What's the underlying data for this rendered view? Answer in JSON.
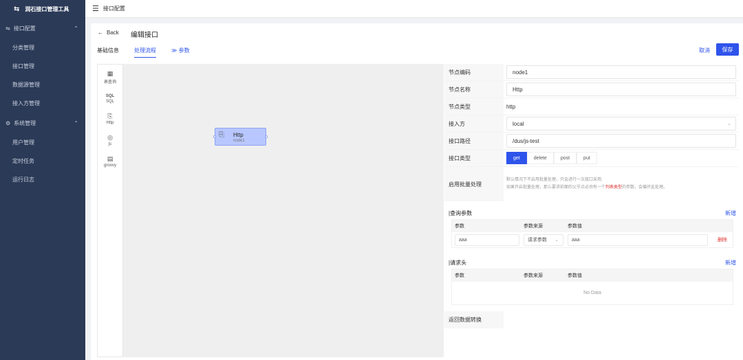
{
  "app": {
    "logo_glyph": "⇆",
    "title": "润石接口管理工具"
  },
  "sidebar": {
    "groups": [
      {
        "label": "接口配置",
        "icon": "link-icon",
        "items": [
          "分类管理",
          "接口管理",
          "数据源管理",
          "接入方管理"
        ]
      },
      {
        "label": "系统管理",
        "icon": "gear-icon",
        "items": [
          "用户管理",
          "定时任务",
          "运行日志"
        ]
      }
    ]
  },
  "header": {
    "breadcrumb": "接口配置"
  },
  "page": {
    "back_label": "Back",
    "title": "编辑接口",
    "tabs": [
      "基础信息",
      "处理流程",
      "≫ 参数"
    ],
    "active_tab": 1,
    "cancel_label": "取消",
    "save_label": "保存"
  },
  "palette": [
    {
      "icon": "table-icon",
      "glyph": "▦",
      "label": "表查询"
    },
    {
      "icon": "sql-icon",
      "glyph": "SQL",
      "label": "SQL"
    },
    {
      "icon": "http-icon",
      "glyph": "⎘",
      "label": "Http"
    },
    {
      "icon": "js-icon",
      "glyph": "◎",
      "label": "js"
    },
    {
      "icon": "groovy-icon",
      "glyph": "▤",
      "label": "groovy"
    }
  ],
  "node": {
    "title": "Http",
    "subtitle": "node1",
    "icon": "http-icon"
  },
  "form": {
    "node_code": {
      "label": "节点编码",
      "value": "node1"
    },
    "node_name": {
      "label": "节点名称",
      "value": "Http"
    },
    "node_type": {
      "label": "节点类型",
      "value": "http"
    },
    "accessor": {
      "label": "接入方",
      "value": "local"
    },
    "api_path": {
      "label": "接口路径",
      "value": "/dus/js-test"
    },
    "method": {
      "label": "接口类型",
      "options": [
        "get",
        "delete",
        "post",
        "put"
      ],
      "selected": 0
    },
    "batch": {
      "label": "启用批量处理",
      "hint_line1": "默认情况下不启用批量处理，只会进行一次接口采用;",
      "hint_line2_a": "如果开启批量处理，那么要求前面的父节点必须有一个",
      "hint_line2_red": "列表类型",
      "hint_line2_b": "的参数，会循环此处理。"
    }
  },
  "query_params": {
    "title": "|查询参数",
    "add_label": "新增",
    "headers": [
      "参数",
      "参数来源",
      "参数值"
    ],
    "rows": [
      {
        "name": "aaa",
        "source": "请求参数",
        "value": "aaa",
        "delete_label": "删除"
      }
    ]
  },
  "request_headers": {
    "title": "|请求头",
    "add_label": "新增",
    "headers": [
      "参数",
      "参数来源",
      "参数值"
    ],
    "empty_text": "No Data"
  },
  "response_transform": {
    "label": "返回数据转换"
  }
}
